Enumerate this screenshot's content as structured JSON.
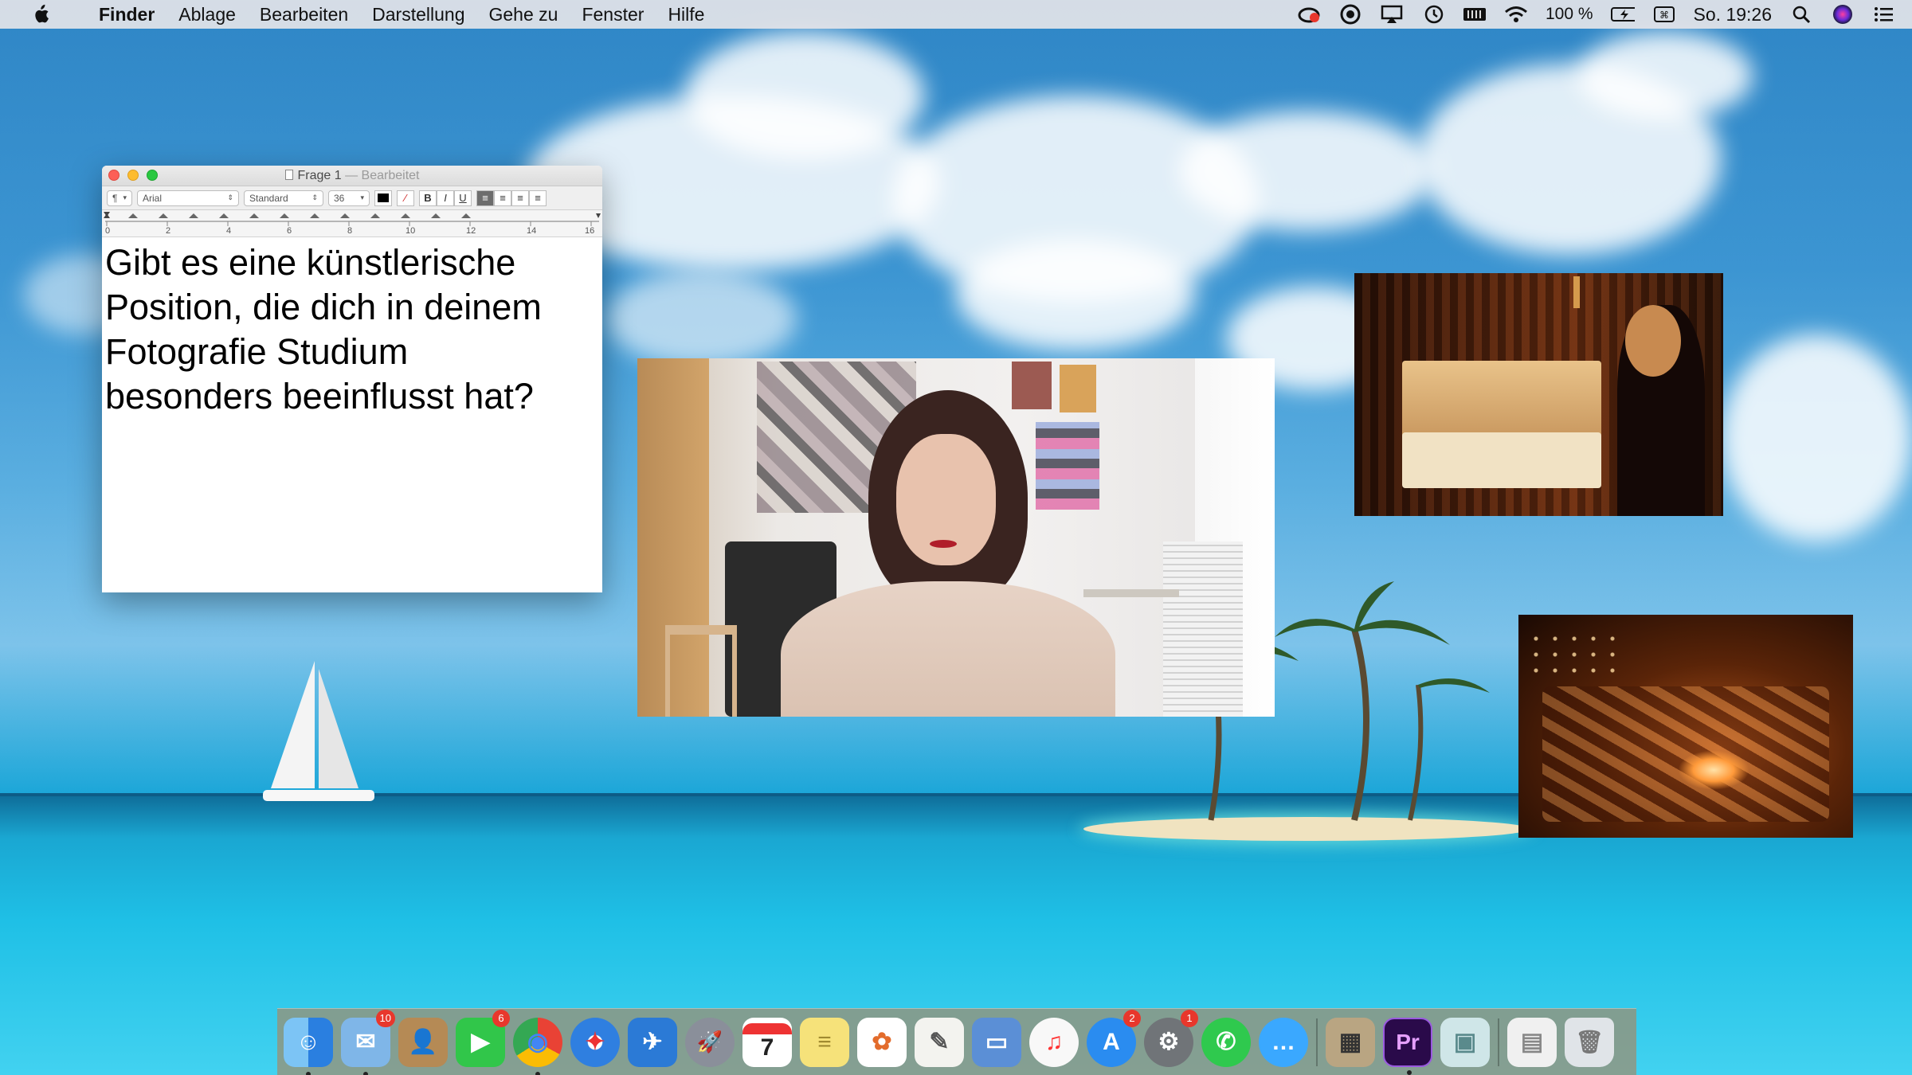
{
  "menubar": {
    "app": "Finder",
    "items": [
      "Ablage",
      "Bearbeiten",
      "Darstellung",
      "Gehe zu",
      "Fenster",
      "Hilfe"
    ],
    "battery": "100 %",
    "clock": "So. 19:26",
    "icons": [
      "apple-icon",
      "creative-cloud-icon",
      "camera-record-icon",
      "airplay-icon",
      "time-machine-icon",
      "battery-indicator-icon",
      "wifi-icon",
      "battery-icon",
      "keyboard-icon",
      "spotlight-icon",
      "siri-icon",
      "notification-center-icon"
    ]
  },
  "textedit": {
    "title": "Frage 1",
    "title_suffix": "— Bearbeitet",
    "font": "Arial",
    "style": "Standard",
    "size": "36",
    "ruler_numbers": [
      "0",
      "2",
      "4",
      "6",
      "8",
      "10",
      "12",
      "14",
      "16"
    ],
    "body_lines": [
      "Gibt es eine künstlerische",
      "Position, die dich in deinem",
      "Fotografie Studium",
      "besonders beeinflusst hat?"
    ]
  },
  "dock": {
    "items": [
      {
        "name": "finder",
        "color": "#3a8fe0",
        "glyph": "☺",
        "running": true
      },
      {
        "name": "mail",
        "color": "#7fb6e8",
        "glyph": "✉",
        "badge": "10",
        "running": true
      },
      {
        "name": "contacts",
        "color": "#b58a55",
        "glyph": "👤"
      },
      {
        "name": "facetime",
        "color": "#31c64a",
        "glyph": "▶",
        "badge": "6"
      },
      {
        "name": "chrome",
        "color": "#e8e8e8",
        "glyph": "◉",
        "running": true
      },
      {
        "name": "safari",
        "color": "#2f7fe0",
        "glyph": "✦"
      },
      {
        "name": "mail-alt",
        "color": "#2b7ad6",
        "glyph": "✈"
      },
      {
        "name": "launchpad",
        "color": "#8a8f9a",
        "glyph": "🚀"
      },
      {
        "name": "calendar",
        "color": "#ffffff",
        "glyph": "7"
      },
      {
        "name": "notes",
        "color": "#f6e27a",
        "glyph": "≡"
      },
      {
        "name": "photos",
        "color": "#ffffff",
        "glyph": "✿"
      },
      {
        "name": "textedit",
        "color": "#f3f3ef",
        "glyph": "✎"
      },
      {
        "name": "keynote",
        "color": "#5b8fd6",
        "glyph": "▭"
      },
      {
        "name": "music",
        "color": "#f8f8f8",
        "glyph": "♫"
      },
      {
        "name": "app-store",
        "color": "#2a8cf0",
        "glyph": "A",
        "badge": "2"
      },
      {
        "name": "system-preferences",
        "color": "#707478",
        "glyph": "⚙",
        "badge": "1"
      },
      {
        "name": "whatsapp",
        "color": "#2fc94e",
        "glyph": "✆"
      },
      {
        "name": "messages",
        "color": "#3aa8ff",
        "glyph": "…"
      },
      {
        "name": "calculator",
        "color": "#b9a582",
        "glyph": "▦"
      },
      {
        "name": "premiere",
        "color": "#2a0a4a",
        "glyph": "Pr",
        "running": true
      },
      {
        "name": "plugin-scan",
        "color": "#cfe6e8",
        "glyph": "▣"
      },
      {
        "name": "documents",
        "color": "#f0f0f0",
        "glyph": "▤"
      },
      {
        "name": "trash",
        "color": "#e0e4e8",
        "glyph": "🗑"
      }
    ]
  }
}
